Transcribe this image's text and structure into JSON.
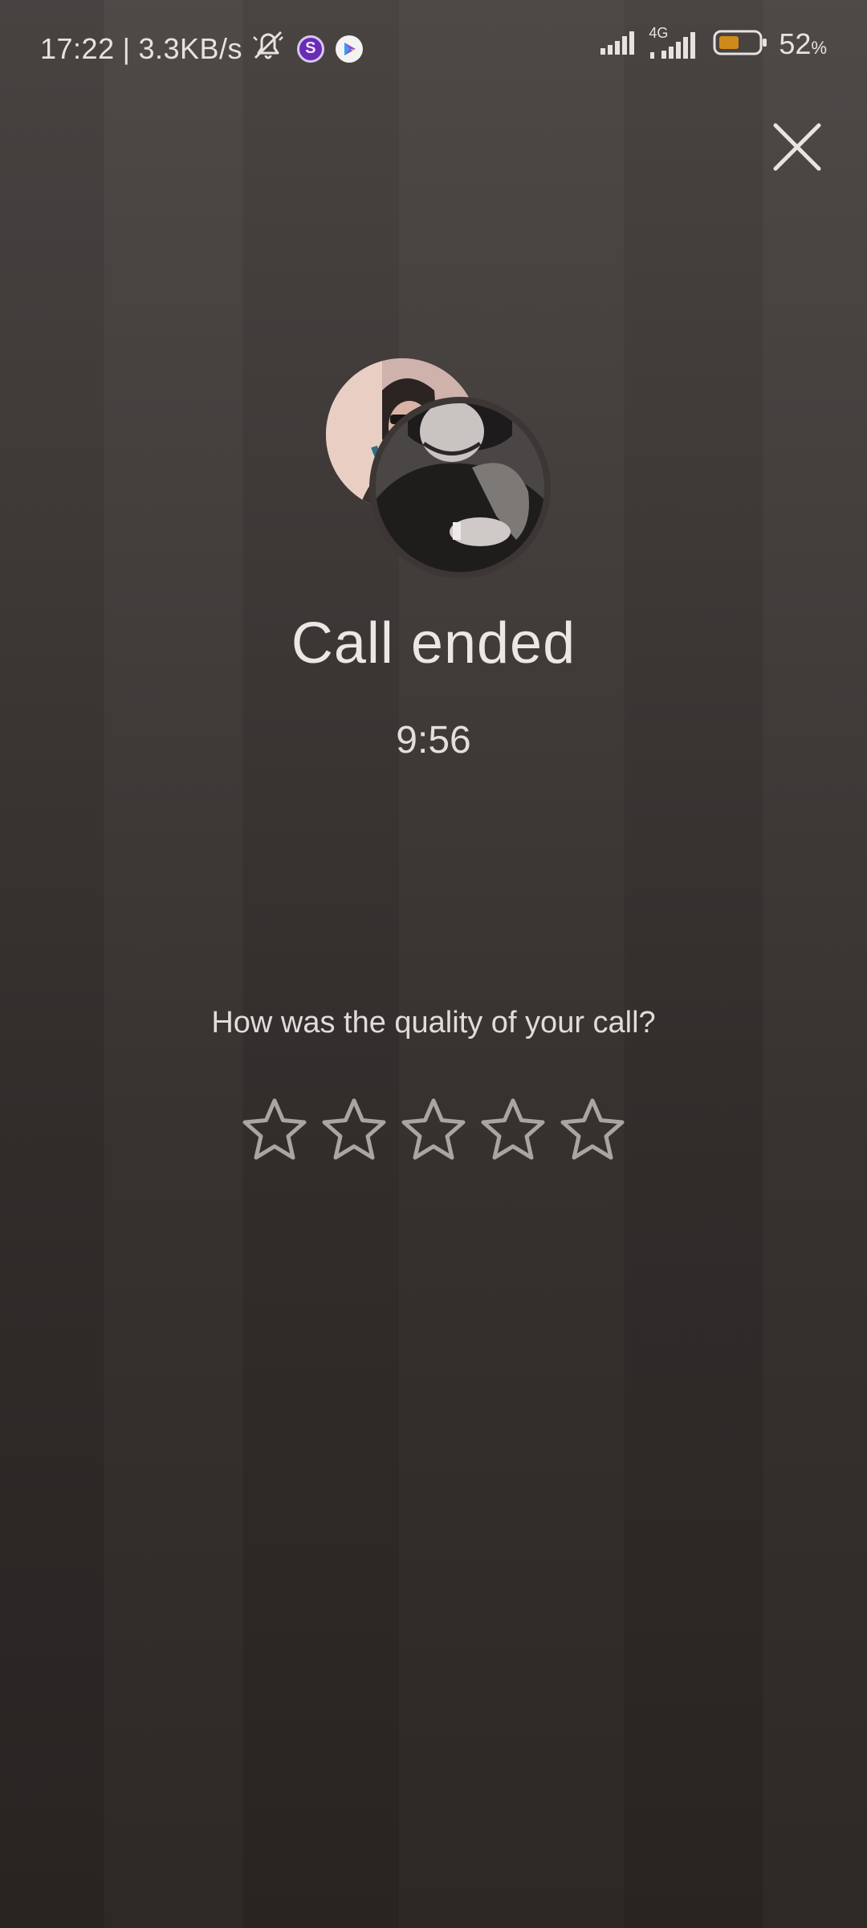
{
  "status_bar": {
    "time": "17:22",
    "separator": "|",
    "speed": "3.3KB/s",
    "network_type": "4G",
    "battery_percent": "52",
    "battery_unit": "%",
    "icons": [
      "mute-bell-icon",
      "app-s-icon",
      "play-store-icon",
      "signal-icon",
      "signal-4g-icon",
      "battery-icon"
    ]
  },
  "call": {
    "title": "Call ended",
    "duration": "9:56"
  },
  "rating": {
    "question": "How was the quality of your call?",
    "max_stars": 5,
    "selected": 0
  },
  "colors": {
    "background_top": "#4b4644",
    "background_bottom": "#2a2523",
    "text": "#ebe7e4",
    "star_outline": "#a9a5a3",
    "battery_fill": "#d08a1c"
  }
}
